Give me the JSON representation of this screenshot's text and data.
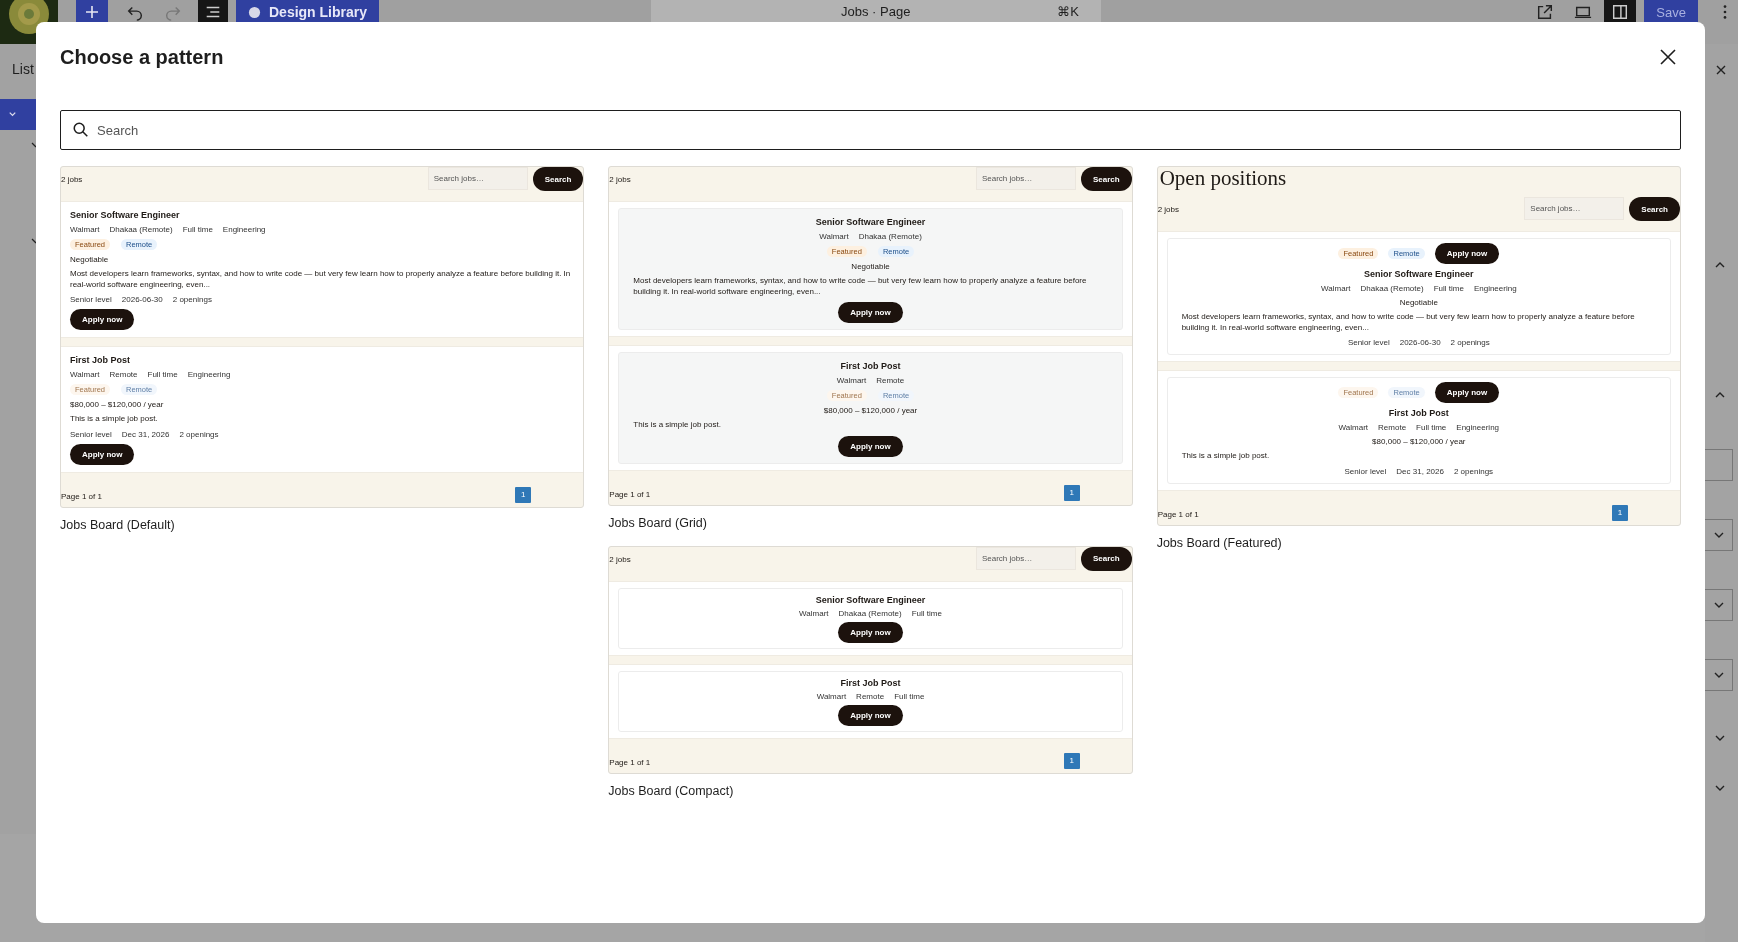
{
  "editor": {
    "toolbar": {
      "design_library": "Design Library",
      "document_title": "Jobs · Page",
      "shortcut": "⌘K",
      "save": {
        "label": "Save",
        "disabled": true
      }
    },
    "left_panel": {
      "tab": "List"
    }
  },
  "modal": {
    "title": "Choose a pattern",
    "search": {
      "placeholder": "Search"
    },
    "columns": [
      {
        "patterns": [
          {
            "kind": "default",
            "label": "Jobs Board (Default)",
            "count": "2 jobs",
            "search_placeholder": "Search jobs…",
            "search_button": "Search",
            "page_info": "Page 1 of 1",
            "pages": [
              {
                "label": "1",
                "selected": true
              }
            ],
            "jobs": [
              {
                "title": "Senior Software Engineer",
                "meta": [
                  "Walmart",
                  "Dhakaa (Remote)",
                  "Full time",
                  "Engineering"
                ],
                "tags": [
                  {
                    "label": "Featured",
                    "kind": "featured",
                    "faded": false
                  },
                  {
                    "label": "Remote",
                    "kind": "remote",
                    "faded": false
                  }
                ],
                "salary": "Negotiable",
                "description": "Most developers learn frameworks, syntax, and how to write code — but very few learn how to properly analyze a feature before building it. In real-world software engineering, even...",
                "details": [
                  "Senior level",
                  "2026-06-30",
                  "2 openings"
                ],
                "apply": "Apply now"
              },
              {
                "title": "First Job Post",
                "meta": [
                  "Walmart",
                  "Remote",
                  "Full time",
                  "Engineering"
                ],
                "tags": [
                  {
                    "label": "Featured",
                    "kind": "featured",
                    "faded": true
                  },
                  {
                    "label": "Remote",
                    "kind": "remote",
                    "faded": true
                  }
                ],
                "salary": "$80,000 – $120,000 / year",
                "description": "This is a simple job post.",
                "details": [
                  "Senior level",
                  "Dec 31, 2026",
                  "2 openings"
                ],
                "apply": "Apply now"
              }
            ]
          }
        ]
      },
      {
        "patterns": [
          {
            "kind": "grid",
            "label": "Jobs Board (Grid)",
            "count": "2 jobs",
            "search_placeholder": "Search jobs…",
            "search_button": "Search",
            "page_info": "Page 1 of 1",
            "pages": [
              {
                "label": "1",
                "selected": true
              }
            ],
            "jobs": [
              {
                "title": "Senior Software Engineer",
                "meta": [
                  "Walmart",
                  "Dhakaa (Remote)"
                ],
                "tags": [
                  {
                    "label": "Featured",
                    "kind": "featured",
                    "faded": false
                  },
                  {
                    "label": "Remote",
                    "kind": "remote",
                    "faded": false
                  }
                ],
                "salary": "Negotiable",
                "description": "Most developers learn frameworks, syntax, and how to write code — but very few learn how to properly analyze a feature before building it. In real-world software engineering, even...",
                "apply": "Apply now"
              },
              {
                "title": "First Job Post",
                "meta": [
                  "Walmart",
                  "Remote"
                ],
                "tags": [
                  {
                    "label": "Featured",
                    "kind": "featured",
                    "faded": true
                  },
                  {
                    "label": "Remote",
                    "kind": "remote",
                    "faded": true
                  }
                ],
                "salary": "$80,000 – $120,000 / year",
                "description": "This is a simple job post.",
                "apply": "Apply now"
              }
            ]
          },
          {
            "kind": "compact",
            "label": "Jobs Board (Compact)",
            "count": "2 jobs",
            "search_placeholder": "Search jobs…",
            "search_button": "Search",
            "page_info": "Page 1 of 1",
            "pages": [
              {
                "label": "1",
                "selected": true
              }
            ],
            "jobs": [
              {
                "title": "Senior Software Engineer",
                "meta": [
                  "Walmart",
                  "Dhakaa (Remote)",
                  "Full time"
                ],
                "apply": "Apply now"
              },
              {
                "title": "First Job Post",
                "meta": [
                  "Walmart",
                  "Remote",
                  "Full time"
                ],
                "apply": "Apply now"
              }
            ]
          }
        ]
      },
      {
        "patterns": [
          {
            "kind": "featured",
            "label": "Jobs Board (Featured)",
            "heading": "Open positions",
            "count": "2 jobs",
            "search_placeholder": "Search jobs…",
            "search_button": "Search",
            "page_info": "Page 1 of 1",
            "pages": [
              {
                "label": "1",
                "selected": true
              }
            ],
            "jobs": [
              {
                "title": "Senior Software Engineer",
                "meta": [
                  "Walmart",
                  "Dhakaa (Remote)",
                  "Full time",
                  "Engineering"
                ],
                "tags": [
                  {
                    "label": "Featured",
                    "kind": "featured",
                    "faded": false
                  },
                  {
                    "label": "Remote",
                    "kind": "remote",
                    "faded": false
                  }
                ],
                "salary": "Negotiable",
                "description": "Most developers learn frameworks, syntax, and how to write code — but very few learn how to properly analyze a feature before building it. In real-world software engineering, even...",
                "details": [
                  "Senior level",
                  "2026-06-30",
                  "2 openings"
                ],
                "apply": "Apply now"
              },
              {
                "title": "First Job Post",
                "meta": [
                  "Walmart",
                  "Remote",
                  "Full time",
                  "Engineering"
                ],
                "tags": [
                  {
                    "label": "Featured",
                    "kind": "featured",
                    "faded": true
                  },
                  {
                    "label": "Remote",
                    "kind": "remote",
                    "faded": true
                  }
                ],
                "salary": "$80,000 – $120,000 / year",
                "description": "This is a simple job post.",
                "details": [
                  "Senior level",
                  "Dec 31, 2026",
                  "2 openings"
                ],
                "apply": "Apply now"
              }
            ]
          }
        ]
      }
    ]
  }
}
